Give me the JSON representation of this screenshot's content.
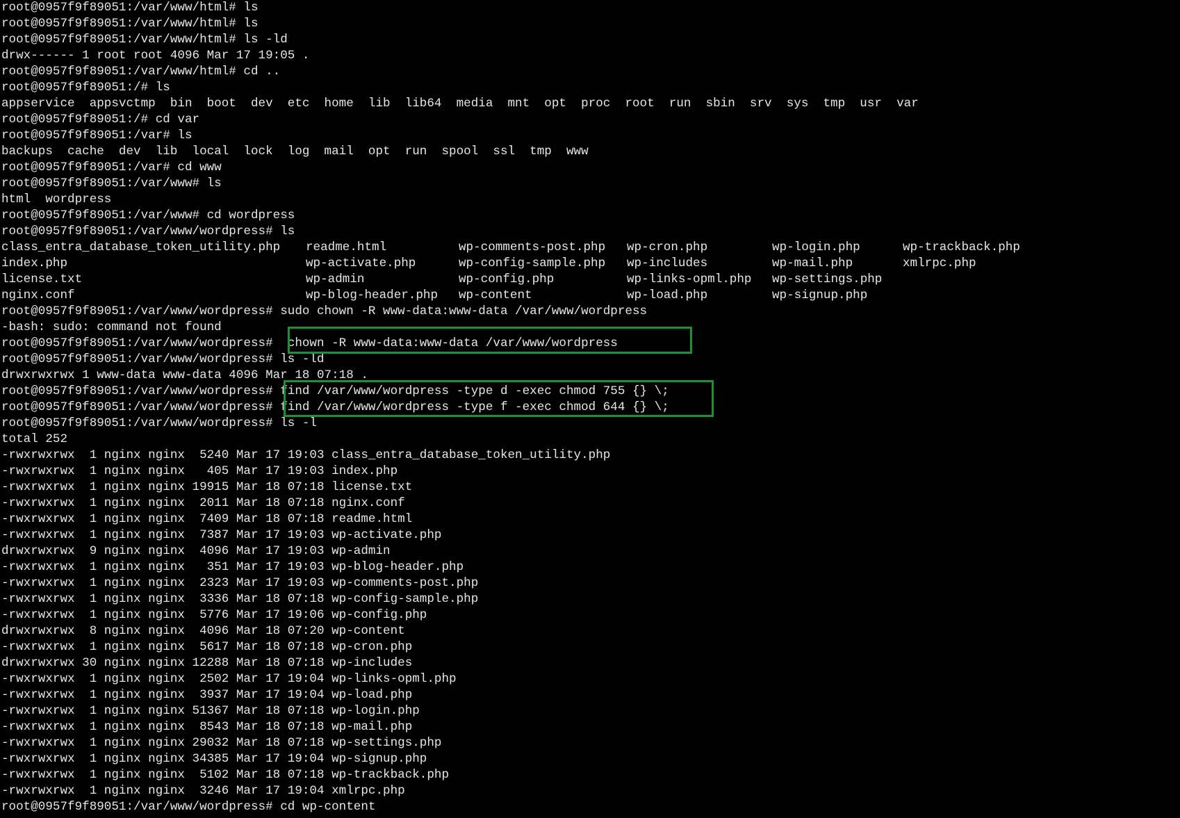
{
  "terminal": {
    "lines_top": [
      "root@0957f9f89051:/var/www/html# ls",
      "root@0957f9f89051:/var/www/html# ls",
      "root@0957f9f89051:/var/www/html# ls -ld",
      "drwx------ 1 root root 4096 Mar 17 19:05 .",
      "root@0957f9f89051:/var/www/html# cd ..",
      "root@0957f9f89051:/# ls",
      "appservice  appsvctmp  bin  boot  dev  etc  home  lib  lib64  media  mnt  opt  proc  root  run  sbin  srv  sys  tmp  usr  var",
      "root@0957f9f89051:/# cd var",
      "root@0957f9f89051:/var# ls",
      "backups  cache  dev  lib  local  lock  log  mail  opt  run  spool  ssl  tmp  www",
      "root@0957f9f89051:/var# cd www",
      "root@0957f9f89051:/var/www# ls",
      "html  wordpress",
      "root@0957f9f89051:/var/www# cd wordpress",
      "root@0957f9f89051:/var/www/wordpress# ls"
    ],
    "ls_grid": [
      [
        "class_entra_database_token_utility.php",
        "readme.html",
        "wp-comments-post.php",
        "wp-cron.php",
        "wp-login.php",
        "wp-trackback.php"
      ],
      [
        "index.php",
        "wp-activate.php",
        "wp-config-sample.php",
        "wp-includes",
        "wp-mail.php",
        "xmlrpc.php"
      ],
      [
        "license.txt",
        "wp-admin",
        "wp-config.php",
        "wp-links-opml.php",
        "wp-settings.php",
        ""
      ],
      [
        "nginx.conf",
        "wp-blog-header.php",
        "wp-content",
        "wp-load.php",
        "wp-signup.php",
        ""
      ]
    ],
    "lines_mid": [
      "root@0957f9f89051:/var/www/wordpress# sudo chown -R www-data:www-data /var/www/wordpress",
      "-bash: sudo: command not found",
      "root@0957f9f89051:/var/www/wordpress#  chown -R www-data:www-data /var/www/wordpress",
      "root@0957f9f89051:/var/www/wordpress# ls -ld",
      "drwxrwxrwx 1 www-data www-data 4096 Mar 18 07:18 .",
      "root@0957f9f89051:/var/www/wordpress# find /var/www/wordpress -type d -exec chmod 755 {} \\;",
      "root@0957f9f89051:/var/www/wordpress# find /var/www/wordpress -type f -exec chmod 644 {} \\;",
      "root@0957f9f89051:/var/www/wordpress# ls -l",
      "total 252"
    ],
    "ls_long": [
      "-rwxrwxrwx  1 nginx nginx  5240 Mar 17 19:03 class_entra_database_token_utility.php",
      "-rwxrwxrwx  1 nginx nginx   405 Mar 17 19:03 index.php",
      "-rwxrwxrwx  1 nginx nginx 19915 Mar 18 07:18 license.txt",
      "-rwxrwxrwx  1 nginx nginx  2011 Mar 18 07:18 nginx.conf",
      "-rwxrwxrwx  1 nginx nginx  7409 Mar 18 07:18 readme.html",
      "-rwxrwxrwx  1 nginx nginx  7387 Mar 17 19:03 wp-activate.php",
      "drwxrwxrwx  9 nginx nginx  4096 Mar 17 19:03 wp-admin",
      "-rwxrwxrwx  1 nginx nginx   351 Mar 17 19:03 wp-blog-header.php",
      "-rwxrwxrwx  1 nginx nginx  2323 Mar 17 19:03 wp-comments-post.php",
      "-rwxrwxrwx  1 nginx nginx  3336 Mar 18 07:18 wp-config-sample.php",
      "-rwxrwxrwx  1 nginx nginx  5776 Mar 17 19:06 wp-config.php",
      "drwxrwxrwx  8 nginx nginx  4096 Mar 18 07:20 wp-content",
      "-rwxrwxrwx  1 nginx nginx  5617 Mar 18 07:18 wp-cron.php",
      "drwxrwxrwx 30 nginx nginx 12288 Mar 18 07:18 wp-includes",
      "-rwxrwxrwx  1 nginx nginx  2502 Mar 17 19:04 wp-links-opml.php",
      "-rwxrwxrwx  1 nginx nginx  3937 Mar 17 19:04 wp-load.php",
      "-rwxrwxrwx  1 nginx nginx 51367 Mar 18 07:18 wp-login.php",
      "-rwxrwxrwx  1 nginx nginx  8543 Mar 18 07:18 wp-mail.php",
      "-rwxrwxrwx  1 nginx nginx 29032 Mar 18 07:18 wp-settings.php",
      "-rwxrwxrwx  1 nginx nginx 34385 Mar 17 19:04 wp-signup.php",
      "-rwxrwxrwx  1 nginx nginx  5102 Mar 18 07:18 wp-trackback.php",
      "-rwxrwxrwx  1 nginx nginx  3246 Mar 17 19:04 xmlrpc.php"
    ],
    "lines_bottom": [
      "root@0957f9f89051:/var/www/wordpress# cd wp-content"
    ]
  },
  "colors": {
    "background": "#000000",
    "text": "#e6e6e6",
    "highlight_box": "#1f8f2f"
  }
}
